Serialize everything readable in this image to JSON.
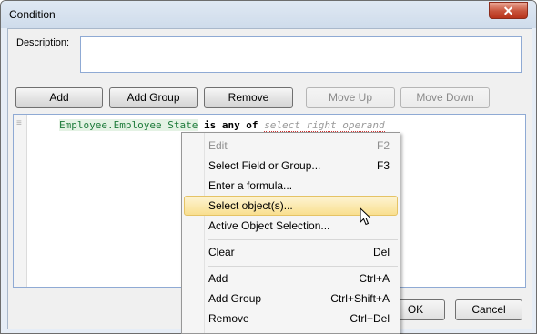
{
  "window": {
    "title": "Condition",
    "close_glyph": "✕"
  },
  "description": {
    "label": "Description:",
    "value": ""
  },
  "toolbar": {
    "add": "Add",
    "add_group": "Add Group",
    "remove": "Remove",
    "move_up": "Move Up",
    "move_down": "Move Down"
  },
  "editor": {
    "gutter_glyph": "≡",
    "field": "Employee.Employee State",
    "operator": "is any of",
    "right_operand_placeholder": "select right operand"
  },
  "context_menu": {
    "edit": {
      "label": "Edit",
      "shortcut": "F2"
    },
    "select_field": {
      "label": "Select Field or Group...",
      "shortcut": "F3"
    },
    "enter_formula": {
      "label": "Enter a formula..."
    },
    "select_objects": {
      "label": "Select object(s)..."
    },
    "active_selection": {
      "label": "Active Object Selection..."
    },
    "clear": {
      "label": "Clear",
      "shortcut": "Del"
    },
    "add": {
      "label": "Add",
      "shortcut": "Ctrl+A"
    },
    "add_group": {
      "label": "Add Group",
      "shortcut": "Ctrl+Shift+A"
    },
    "remove": {
      "label": "Remove",
      "shortcut": "Ctrl+Del"
    }
  },
  "footer": {
    "ok": "OK",
    "cancel": "Cancel"
  }
}
